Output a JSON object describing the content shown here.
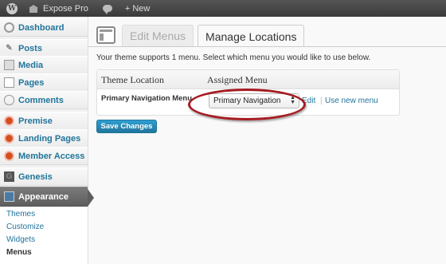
{
  "admin_bar": {
    "wp_logo": "W",
    "site_name": "Expose Pro",
    "new_label": "+ New",
    "icons": [
      "wordpress-icon",
      "site-home-icon",
      "comments-icon",
      "plus-icon"
    ]
  },
  "sidebar": {
    "items": [
      {
        "label": "Dashboard",
        "icon": "dashboard-icon"
      },
      {
        "label": "Posts",
        "icon": "posts-icon"
      },
      {
        "label": "Media",
        "icon": "media-icon"
      },
      {
        "label": "Pages",
        "icon": "pages-icon"
      },
      {
        "label": "Comments",
        "icon": "comments-icon"
      },
      {
        "label": "Premise",
        "icon": "premise-icon"
      },
      {
        "label": "Landing Pages",
        "icon": "landing-pages-icon"
      },
      {
        "label": "Member Access",
        "icon": "member-access-icon"
      },
      {
        "label": "Genesis",
        "icon": "genesis-icon"
      },
      {
        "label": "Appearance",
        "icon": "appearance-icon"
      }
    ],
    "submenu": [
      "Themes",
      "Customize",
      "Widgets",
      "Menus"
    ]
  },
  "main": {
    "tabs": [
      {
        "label": "Edit Menus"
      },
      {
        "label": "Manage Locations"
      }
    ],
    "intro": "Your theme supports 1 menu. Select which menu you would like to use below.",
    "table": {
      "col_location": "Theme Location",
      "col_assigned": "Assigned Menu",
      "row_name": "Primary Navigation Menu",
      "selected_menu": "Primary Navigation",
      "edit_link": "Edit",
      "separator": "|",
      "new_link": "Use new menu"
    },
    "save_button": "Save Changes"
  },
  "colors": {
    "link": "#21759b",
    "highlight_oval": "#a51c22",
    "primary_button": "#21759b",
    "admin_bar": "#464646"
  }
}
